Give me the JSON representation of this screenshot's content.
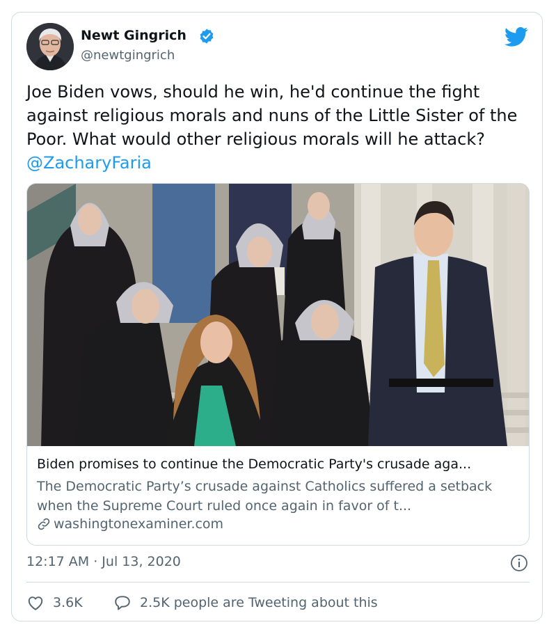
{
  "author": {
    "name": "Newt Gingrich",
    "handle": "@newtgingrich"
  },
  "tweet": {
    "text": "Joe Biden vows, should he win, he'd continue the fight against religious morals and nuns of the Little Sister of the Poor. What would other religious morals will he attack? ",
    "mention": "@ZacharyFaria"
  },
  "link_card": {
    "title": "Biden promises to continue the Democratic Party's crusade aga...",
    "description": "The Democratic Party’s crusade against Catholics suffered a setback when the Supreme Court ruled once again in favor of t...",
    "domain": "washingtonexaminer.com"
  },
  "timestamp": "12:17 AM · Jul 13, 2020",
  "actions": {
    "likes": "3.6K",
    "tweeting_about": "2.5K people are Tweeting about this"
  },
  "icons": {
    "verified": "verified-badge-icon",
    "brand": "twitter-bird-icon",
    "link": "link-icon",
    "info": "info-icon",
    "like": "heart-icon",
    "reply": "speech-bubble-icon"
  },
  "colors": {
    "accent": "#1d9bf0",
    "text_primary": "#0f1419",
    "text_secondary": "#536471",
    "border": "#cfd9de"
  }
}
